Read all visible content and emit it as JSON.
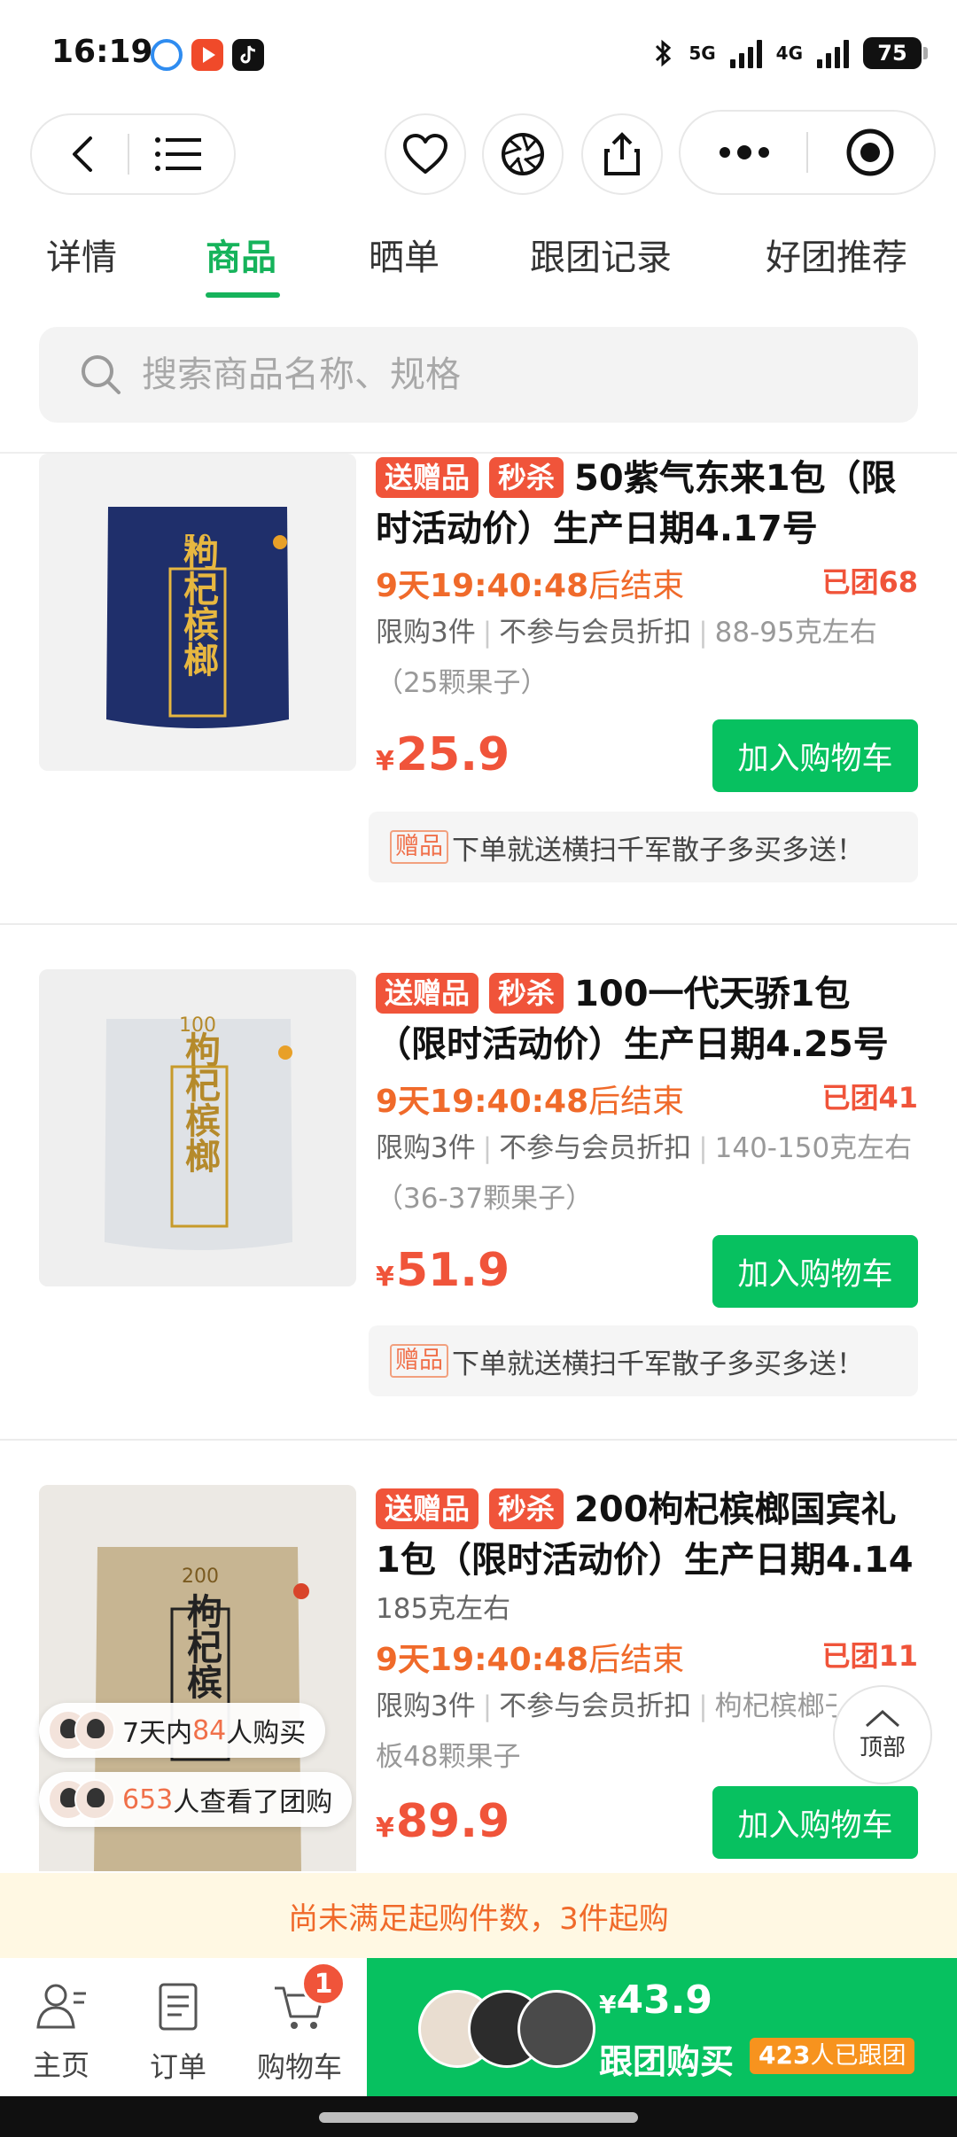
{
  "status_bar": {
    "time": "16:19",
    "signal1": "5G",
    "signal2": "4G",
    "battery": "75"
  },
  "tabs": [
    {
      "label": "详情"
    },
    {
      "label": "商品"
    },
    {
      "label": "晒单"
    },
    {
      "label": "跟团记录"
    },
    {
      "label": "好团推荐"
    }
  ],
  "search": {
    "placeholder": "搜索商品名称、规格"
  },
  "products": [
    {
      "tags": [
        "送赠品",
        "秒杀"
      ],
      "title": "50紫气东来1包（限时活动价）生产日期4.17号",
      "subtitle": "",
      "countdown": "9天19:40:48",
      "countdown_suffix": "后结束",
      "grouped": "已团68",
      "limit": "限购3件",
      "discount_note": "不参与会员折扣",
      "spec": "88-95克左右（25颗果子）",
      "currency": "¥",
      "price": "25.9",
      "cart_label": "加入购物车",
      "gift_tag": "赠品",
      "gift_text": "下单就送横扫千军散子多买多送！"
    },
    {
      "tags": [
        "送赠品",
        "秒杀"
      ],
      "title": "100一代天骄1包（限时活动价）生产日期4.25号",
      "subtitle": "",
      "countdown": "9天19:40:48",
      "countdown_suffix": "后结束",
      "grouped": "已团41",
      "limit": "限购3件",
      "discount_note": "不参与会员折扣",
      "spec": "140-150克左右（36-37颗果子）",
      "currency": "¥",
      "price": "51.9",
      "cart_label": "加入购物车",
      "gift_tag": "赠品",
      "gift_text": "下单就送横扫千军散子多买多送！"
    },
    {
      "tags": [
        "送赠品",
        "秒杀"
      ],
      "title": "200枸杞槟榔国宾礼1包（限时活动价）生产日期4.14",
      "subtitle": "185克左右",
      "countdown": "9天19:40:48",
      "countdown_suffix": "后结束",
      "grouped": "已团11",
      "limit": "限购3件",
      "discount_note": "不参与会员折扣",
      "spec": "枸杞槟榔子",
      "spec_line2": "板48颗果子",
      "currency": "¥",
      "price": "89.9",
      "cart_label": "加入购物车"
    }
  ],
  "product_images": [
    {
      "label": "枸杞槟榔",
      "badge": "50",
      "bag_color": "#1f2f6b"
    },
    {
      "label": "枸杞槟榔",
      "badge": "100",
      "bag_color": "#dfe2e6"
    },
    {
      "label": "枸杞槟",
      "badge": "200",
      "bag_color": "#c7b592"
    }
  ],
  "social_proof": {
    "buyers_prefix": "7天内",
    "buyers_count": "84",
    "buyers_suffix": "人购买",
    "viewers_count": "653",
    "viewers_suffix": "人查看了团购"
  },
  "to_top_label": "顶部",
  "min_purchase_notice": "尚未满足起购件数，3件起购",
  "bottom_nav": {
    "home": "主页",
    "orders": "订单",
    "cart": "购物车",
    "cart_badge": "1"
  },
  "join_group": {
    "currency": "¥",
    "price": "43.9",
    "label": "跟团购买",
    "joined_count": "423",
    "joined_suffix": "人已跟团"
  },
  "colors": {
    "accent_green": "#07c160",
    "tab_green": "#16b35b",
    "price_red": "#f0543a",
    "timer_orange": "#f06a2a"
  }
}
